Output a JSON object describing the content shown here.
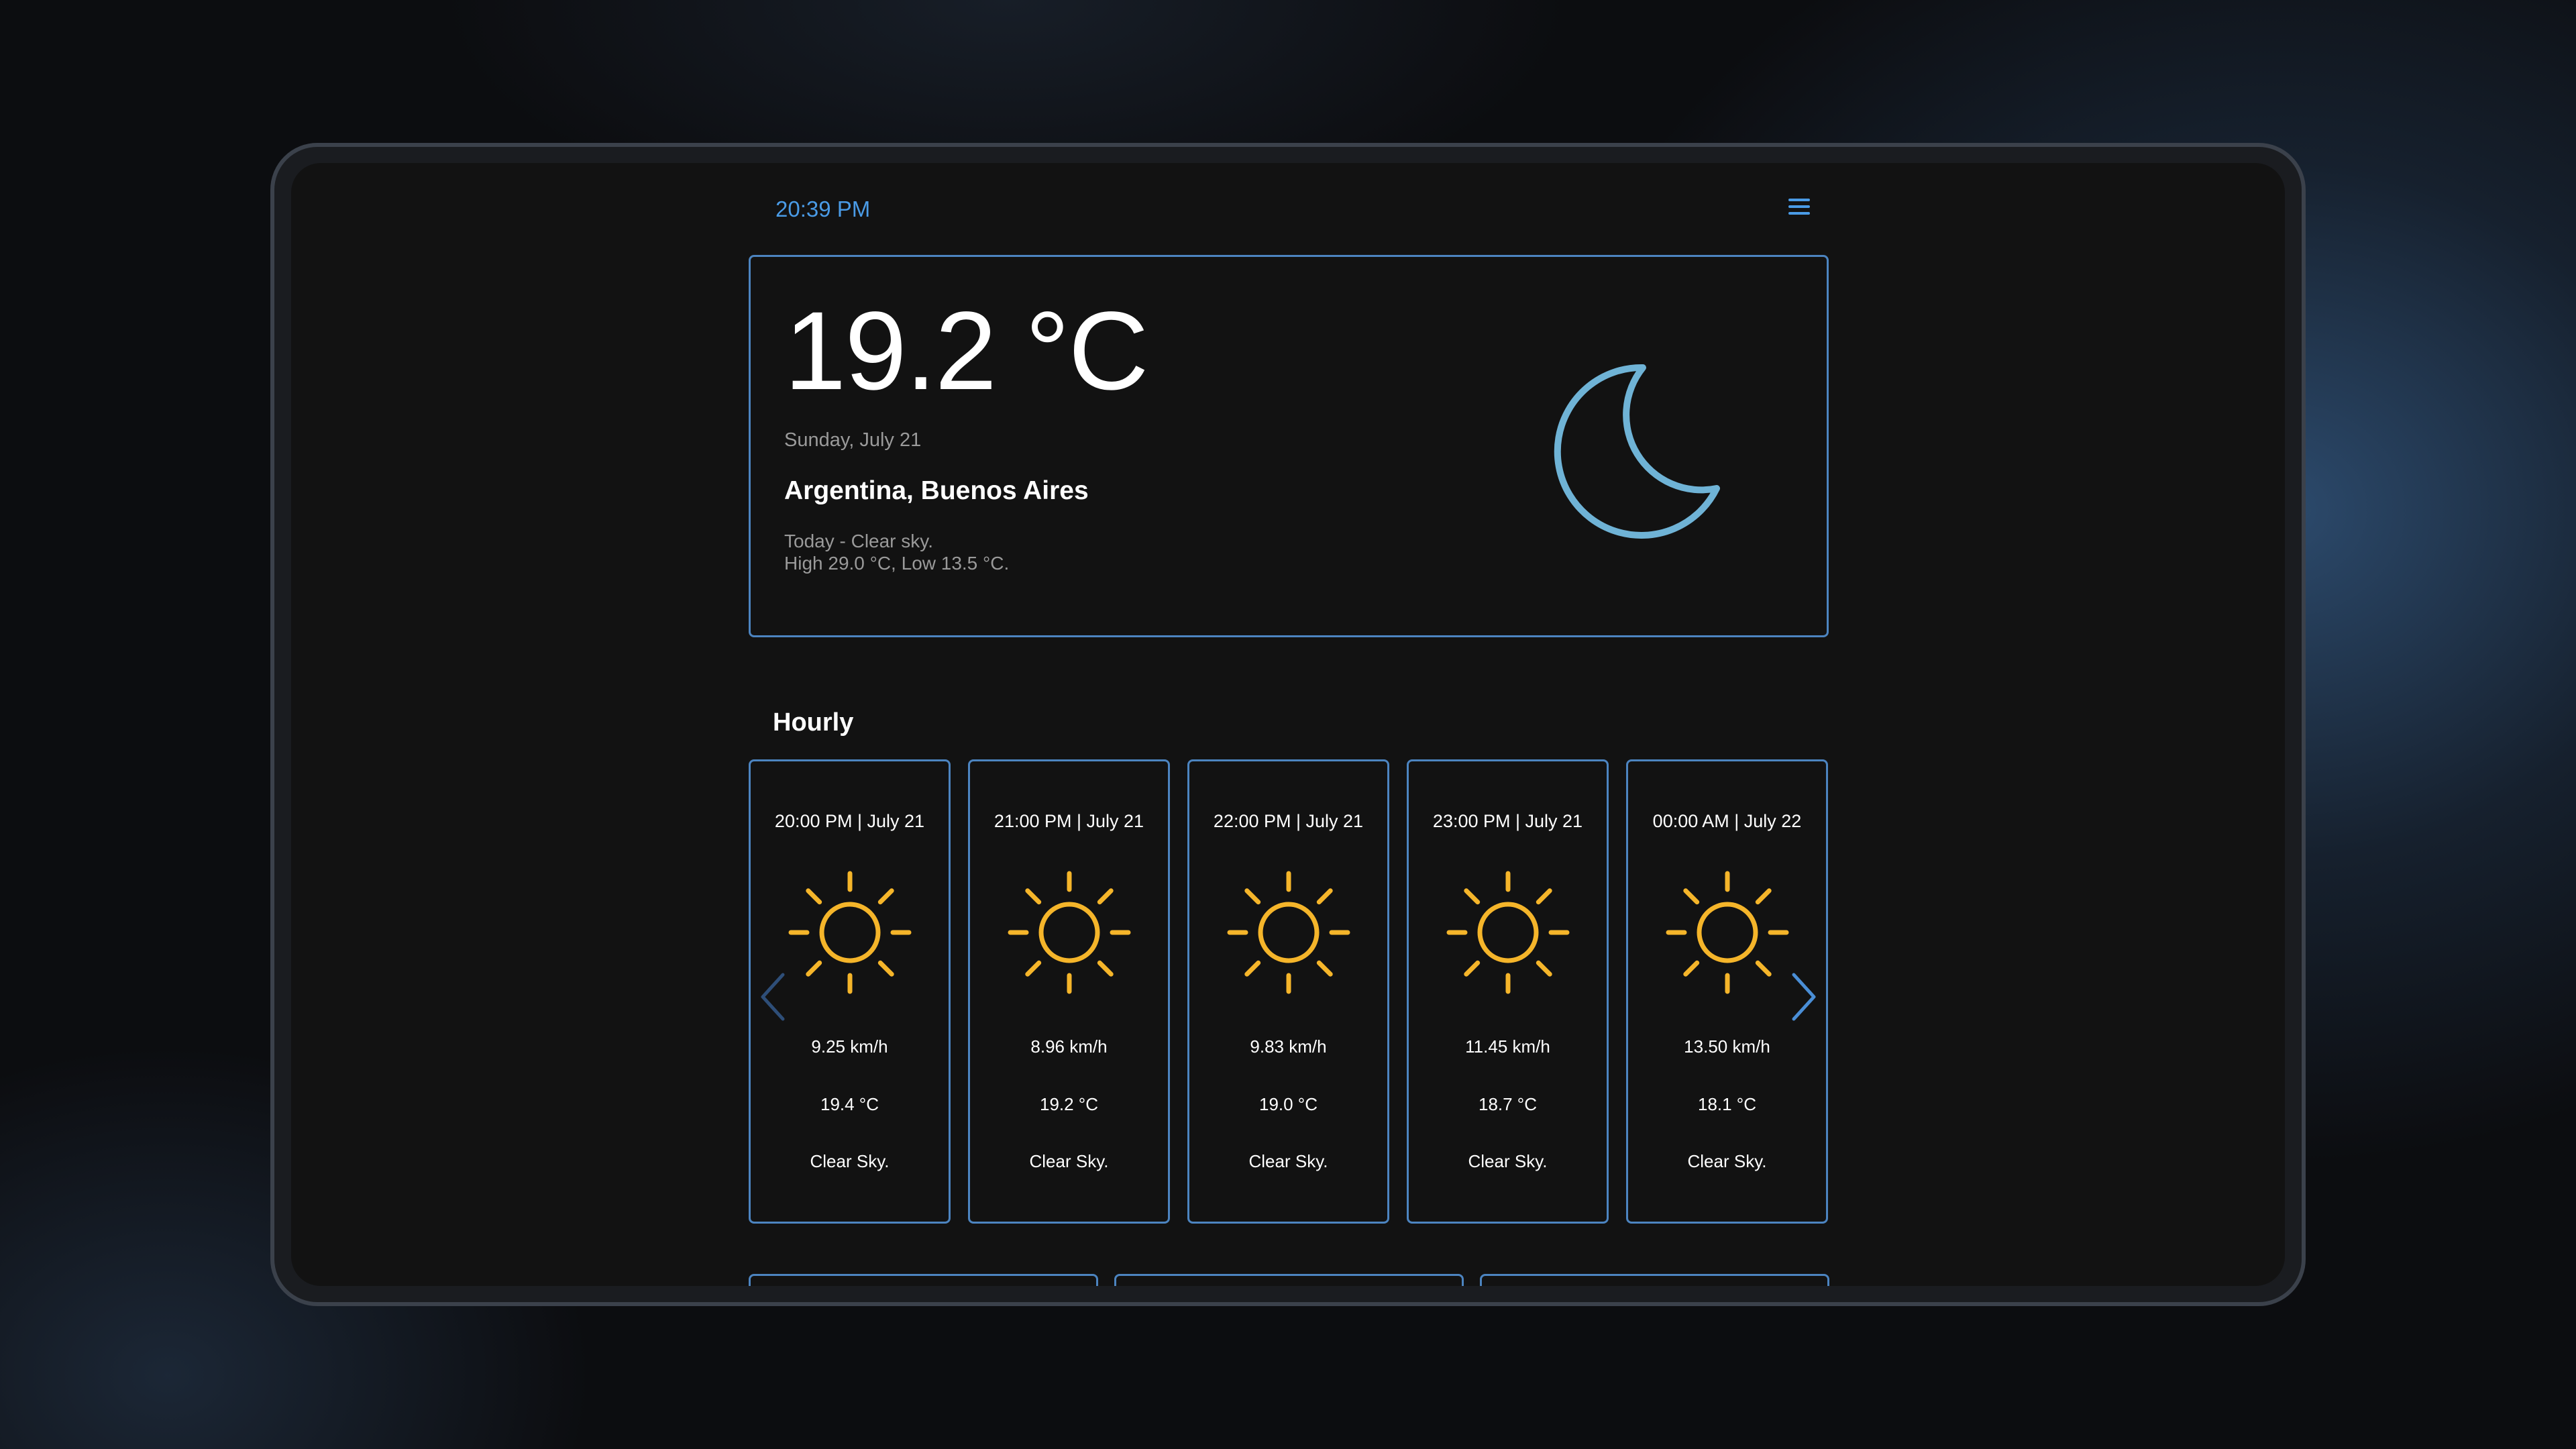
{
  "header": {
    "time": "20:39 PM",
    "menu_icon": "hamburger-menu-icon"
  },
  "current": {
    "temperature": "19.2 °C",
    "date": "Sunday, July 21",
    "location": "Argentina, Buenos Aires",
    "summary_line1": "Today - Clear sky.",
    "summary_line2": "High 29.0 °C, Low 13.5 °C.",
    "icon": "moon-icon",
    "icon_color": "#6fb3d6"
  },
  "hourly": {
    "title": "Hourly",
    "icon_color": "#f5b52a",
    "items": [
      {
        "time": "20:00 PM | July 21",
        "wind": "9.25 km/h",
        "temp": "19.4 °C",
        "condition": "Clear Sky.",
        "icon": "sun-icon"
      },
      {
        "time": "21:00 PM | July 21",
        "wind": "8.96 km/h",
        "temp": "19.2 °C",
        "condition": "Clear Sky.",
        "icon": "sun-icon"
      },
      {
        "time": "22:00 PM | July 21",
        "wind": "9.83 km/h",
        "temp": "19.0 °C",
        "condition": "Clear Sky.",
        "icon": "sun-icon"
      },
      {
        "time": "23:00 PM | July 21",
        "wind": "11.45 km/h",
        "temp": "18.7 °C",
        "condition": "Clear Sky.",
        "icon": "sun-icon"
      },
      {
        "time": "00:00 AM | July 22",
        "wind": "13.50 km/h",
        "temp": "18.1 °C",
        "condition": "Clear Sky.",
        "icon": "sun-icon"
      }
    ],
    "prev_icon": "chevron-left-icon",
    "next_icon": "chevron-right-icon"
  },
  "colors": {
    "accent": "#4a9be6",
    "card_border": "#4c84c0",
    "background": "#121212"
  }
}
